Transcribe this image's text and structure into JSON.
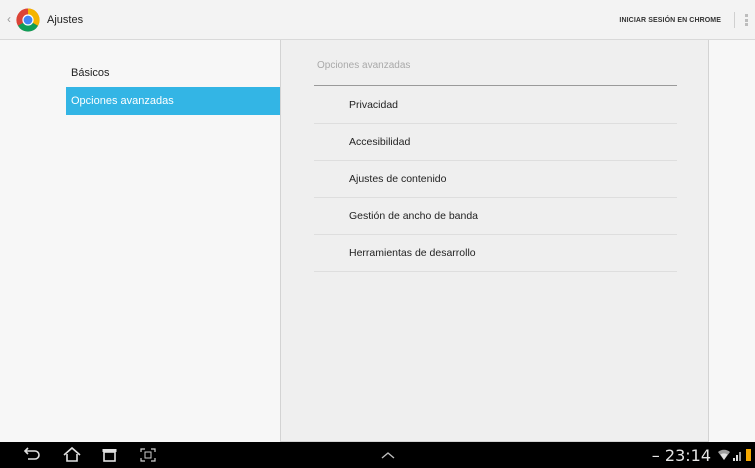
{
  "actionbar": {
    "title": "Ajustes",
    "signin_label": "INICIAR SESIÓN EN CHROME",
    "up_icon": "chevron-left-icon",
    "logo_icon": "chrome-logo-icon",
    "overflow_icon": "overflow-menu-icon"
  },
  "headers": {
    "items": [
      {
        "label": "Básicos",
        "selected": false
      },
      {
        "label": "Opciones avanzadas",
        "selected": true
      }
    ]
  },
  "panel": {
    "title": "Opciones avanzadas",
    "items": [
      {
        "label": "Privacidad"
      },
      {
        "label": "Accesibilidad"
      },
      {
        "label": "Ajustes de contenido"
      },
      {
        "label": "Gestión de ancho de banda"
      },
      {
        "label": "Herramientas de desarrollo"
      }
    ]
  },
  "systembar": {
    "clock": "23:14",
    "nav_icons": [
      "back-icon",
      "home-icon",
      "recent-apps-icon",
      "screenshot-icon",
      "expand-up-icon"
    ],
    "status_icons": [
      "wifi-icon",
      "signal-icon",
      "battery-icon"
    ]
  },
  "colors": {
    "accent": "#33b5e5",
    "actionbar_bg": "#f3f3f3",
    "panel_bg": "#efefef",
    "systembar_bg": "#000000"
  }
}
